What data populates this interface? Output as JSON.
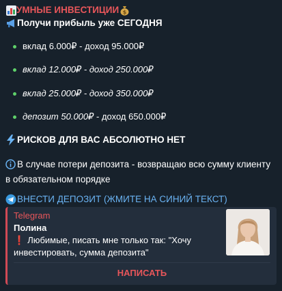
{
  "message": {
    "title": "УМНЫЕ ИНВЕСТИЦИИ",
    "title_icon_left": "bar-chart-icon",
    "title_icon_right": "money-bag-icon",
    "subtitle": "Получи прибыль уже СЕГОДНЯ",
    "subtitle_icon": "megaphone-icon",
    "bullets": [
      {
        "text": "вклад 6.000₽ - доход 95.000₽",
        "italic": false
      },
      {
        "text": "вклад 12.000₽ - доход 250.000₽",
        "italic": true
      },
      {
        "text": "вклад 25.000₽ - доход 350.000₽",
        "italic": true
      },
      {
        "italic_part": "депозит 50.000₽",
        "rest": " - доход 650.000₽"
      }
    ],
    "risk": "РИСКОВ ДЛЯ ВАС АБСОЛЮТНО НЕТ",
    "risk_icon": "lightning-icon",
    "info_line1": "В случае потери депозита - возвращаю всю сумму клиенту",
    "info_line2": "в обязательном порядке",
    "info_icon": "info-icon",
    "deposit_link": "ВНЕСТИ ДЕПОЗИТ (ЖМИТЕ НА СИНИЙ ТЕКСТ)",
    "deposit_icon": "telegram-icon"
  },
  "preview": {
    "site": "Telegram",
    "name": "Полина",
    "text": "Любимые, писать мне только так: \"Хочу инвестировать, сумма депозита\"",
    "exclamation": "❗",
    "button": "НАПИСАТЬ"
  },
  "colors": {
    "background": "#17212b",
    "accent_red": "#e8565a",
    "link_blue": "#6ab3f3",
    "card_bg": "#232e3c"
  }
}
